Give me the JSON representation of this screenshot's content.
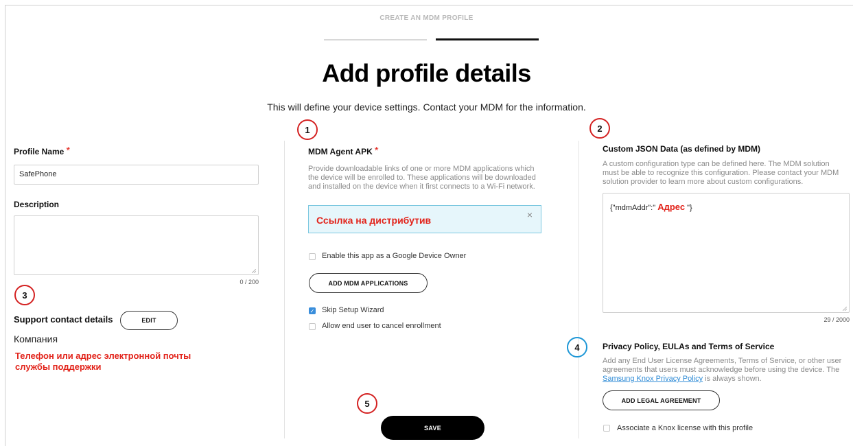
{
  "header": {
    "step_title": "CREATE AN MDM PROFILE",
    "title": "Add profile details",
    "subtitle": "This will define your device settings. Contact your MDM for the information."
  },
  "markers": [
    "1",
    "2",
    "3",
    "4",
    "5"
  ],
  "left": {
    "profile_name_label": "Profile Name",
    "profile_name_value": "SafePhone",
    "description_label": "Description",
    "description_value": "",
    "description_counter": "0 / 200",
    "support_label": "Support contact details",
    "edit_button": "EDIT",
    "company": "Компания",
    "support_note_line1": "Телефон или адрес электронной почты",
    "support_note_line2": "службы поддержки"
  },
  "middle": {
    "apk_label": "MDM Agent APK",
    "apk_helper_line1": "Provide downloadable links of one or more MDM applications which",
    "apk_helper_line2": "the device will be enrolled to. These applications will be downloaded",
    "apk_helper_line3": "and installed on the device when it first connects to a Wi-Fi network.",
    "apk_value": "Ссылка на дистрибутив",
    "apk_clear": "×",
    "google_owner_label": "Enable this app as a Google Device Owner",
    "google_owner_checked": false,
    "add_apps_button": "ADD MDM APPLICATIONS",
    "skip_wizard_label": "Skip Setup Wizard",
    "skip_wizard_checked": true,
    "allow_cancel_label": "Allow end user to cancel enrollment",
    "allow_cancel_checked": false,
    "save_button": "SAVE"
  },
  "right": {
    "json_label": "Custom JSON Data (as defined by MDM)",
    "json_helper_line1": "A custom configuration type can be defined here. The MDM solution",
    "json_helper_line2": "must be able to recognize this configuration. Please contact your MDM",
    "json_helper_line3": "solution provider to learn more about custom configurations.",
    "json_prefix": "{\"mdmAddr\":\"",
    "json_addr": "Адрес",
    "json_suffix": "\"}",
    "json_counter": "29 / 2000",
    "privacy_label": "Privacy Policy, EULAs and Terms of Service",
    "privacy_helper_line1": "Add any End User License Agreements, Terms of Service, or other user",
    "privacy_helper_line2": "agreements that users must acknowledge before using the device. The",
    "privacy_link": "Samsung Knox Privacy Policy",
    "privacy_helper_tail": " is always shown.",
    "add_legal_button": "ADD LEGAL AGREEMENT",
    "knox_license_label": "Associate a Knox license with this profile",
    "knox_license_checked": false
  },
  "colors": {
    "accent_red": "#e2231a",
    "marker_red": "#d42222",
    "marker_blue": "#1c96d6",
    "check_blue": "#3a8edb",
    "apk_box_bg": "#e6f6fb"
  }
}
